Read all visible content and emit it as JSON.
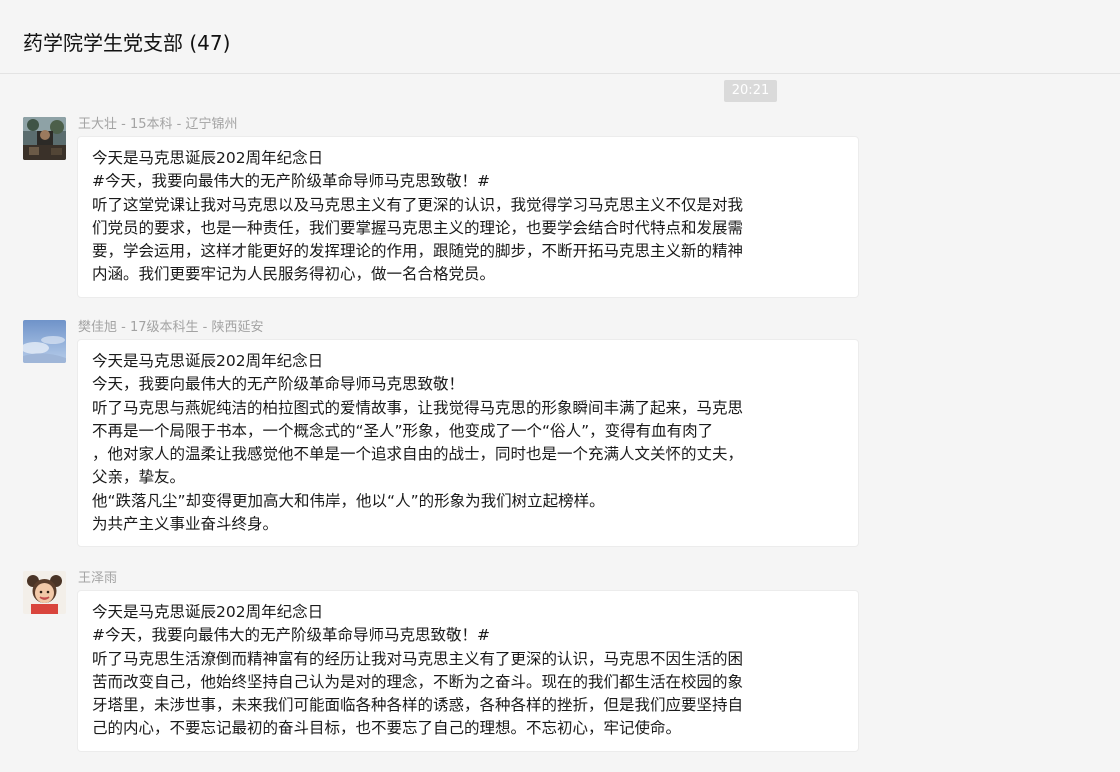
{
  "header": {
    "title": "药学院学生党支部 (47)"
  },
  "chat": {
    "time": "20:21",
    "messages": [
      {
        "sender": "王大壮 - 15本科 - 辽宁锦州",
        "avatar_icon": "avatar-photo-icon",
        "lines": [
          "今天是马克思诞辰202周年纪念日",
          "#今天，我要向最伟大的无产阶级革命导师马克思致敬！#",
          "听了这堂党课让我对马克思以及马克思主义有了更深的认识，我觉得学习马克思主义不仅是对我",
          "们党员的要求，也是一种责任，我们要掌握马克思主义的理论，也要学会结合时代特点和发展需",
          "要，学会运用，这样才能更好的发挥理论的作用，跟随党的脚步，不断开拓马克思主义新的精神",
          "内涵。我们更要牢记为人民服务得初心，做一名合格党员。"
        ]
      },
      {
        "sender": "樊佳旭 - 17级本科生 - 陕西延安",
        "avatar_icon": "avatar-sky-icon",
        "lines": [
          "今天是马克思诞辰202周年纪念日",
          "今天，我要向最伟大的无产阶级革命导师马克思致敬！",
          "听了马克思与燕妮纯洁的柏拉图式的爱情故事，让我觉得马克思的形象瞬间丰满了起来，马克思",
          "不再是一个局限于书本，一个概念式的“圣人”形象，他变成了一个“俗人”，变得有血有肉了",
          "，他对家人的温柔让我感觉他不单是一个追求自由的战士，同时也是一个充满人文关怀的丈夫，",
          "父亲，挚友。",
          "他“跌落凡尘”却变得更加高大和伟岸，他以“人”的形象为我们树立起榜样。",
          "为共产主义事业奋斗终身。"
        ]
      },
      {
        "sender": "王泽雨",
        "avatar_icon": "avatar-child-icon",
        "lines": [
          "今天是马克思诞辰202周年纪念日",
          "#今天，我要向最伟大的无产阶级革命导师马克思致敬！#",
          "听了马克思生活潦倒而精神富有的经历让我对马克思主义有了更深的认识，马克思不因生活的困",
          "苦而改变自己，他始终坚持自己认为是对的理念，不断为之奋斗。现在的我们都生活在校园的象",
          "牙塔里，未涉世事，未来我们可能面临各种各样的诱惑，各种各样的挫折，但是我们应要坚持自",
          "己的内心，不要忘记最初的奋斗目标，也不要忘了自己的理想。不忘初心，牢记使命。"
        ]
      }
    ]
  },
  "colors": {
    "background": "#f5f5f5",
    "bubble": "#ffffff",
    "sender_text": "#a3a3a3",
    "time_badge": "#dadada"
  }
}
